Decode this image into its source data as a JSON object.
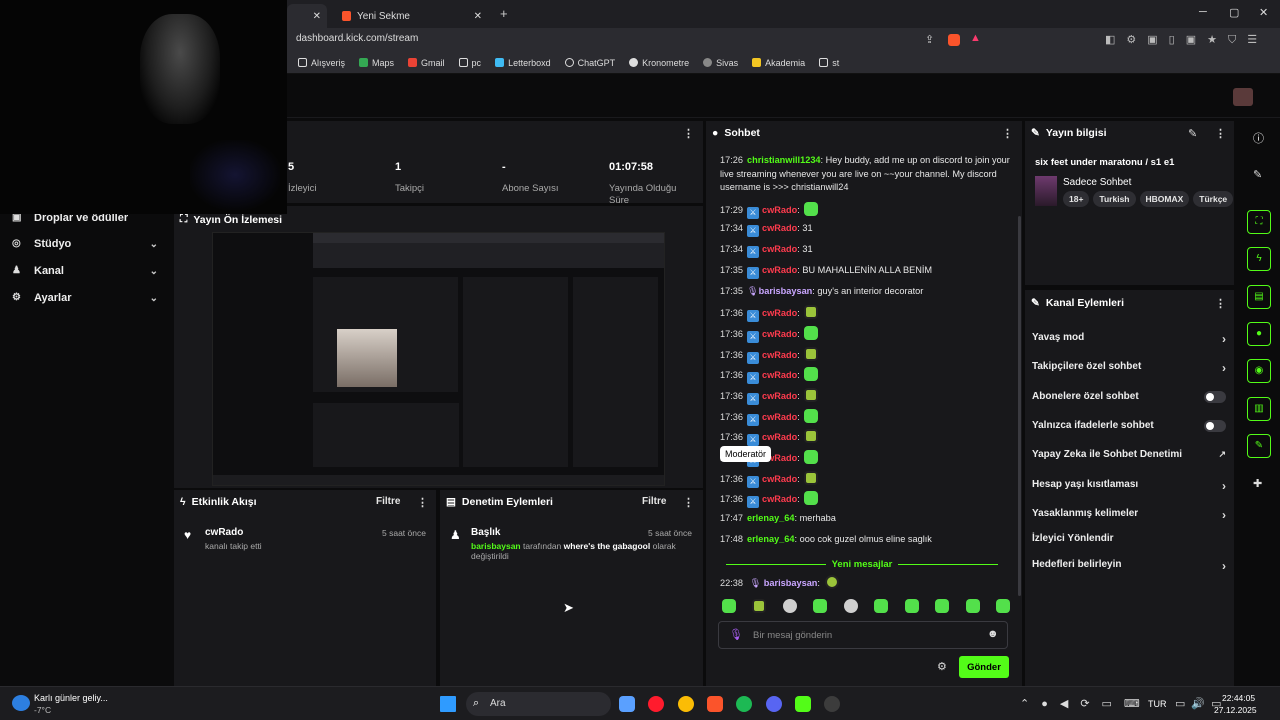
{
  "browser": {
    "tabs": [
      {
        "label": ""
      },
      {
        "label": "Yeni Sekme"
      }
    ],
    "url": "dashboard.kick.com/stream",
    "bookmarks": [
      "Alışveriş",
      "Maps",
      "Gmail",
      "pc",
      "Letterboxd",
      "ChatGPT",
      "Kronometre",
      "Sivas",
      "Akademia",
      "st"
    ]
  },
  "sidebar": {
    "items": [
      {
        "label": "Droplar ve ödüller"
      },
      {
        "label": "Stüdyo"
      },
      {
        "label": "Kanal"
      },
      {
        "label": "Ayarlar"
      }
    ]
  },
  "stats": [
    {
      "value": "5",
      "label": "İzleyici"
    },
    {
      "value": "1",
      "label": "Takipçi"
    },
    {
      "value": "-",
      "label": "Abone Sayısı"
    },
    {
      "value": "01:07:58",
      "label": "Yayında Olduğu Süre"
    }
  ],
  "preview": {
    "title": "Yayın Ön İzlemesi"
  },
  "activity": {
    "title": "Etkinlik Akışı",
    "filter": "Filtre",
    "items": [
      {
        "user": "cwRado",
        "text": "kanalı takip etti",
        "time": "5 saat önce"
      }
    ]
  },
  "moderation": {
    "title": "Denetim Eylemleri",
    "filter": "Filtre",
    "items": [
      {
        "heading": "Başlık",
        "user": "barisbaysan",
        "text1": "tarafından",
        "bold": "where's the gabagool",
        "text2": "olarak değiştirildi",
        "time": "5 saat önce"
      }
    ]
  },
  "chat": {
    "title": "Sohbet",
    "messages": [
      {
        "time": "17:26",
        "user": "christianwill1234",
        "color": "#53fc18",
        "badge": false,
        "text": "Hey buddy, add me up on discord to join your live streaming whenever you are live on ~~your channel. My discord username is >>> christianwill24",
        "emote": ""
      },
      {
        "time": "17:29",
        "user": "cwRado",
        "color": "#ff3b4e",
        "badge": true,
        "text": "",
        "emote": "g"
      },
      {
        "time": "17:34",
        "user": "cwRado",
        "color": "#ff3b4e",
        "badge": true,
        "text": "31",
        "emote": ""
      },
      {
        "time": "17:34",
        "user": "cwRado",
        "color": "#ff3b4e",
        "badge": true,
        "text": "31",
        "emote": ""
      },
      {
        "time": "17:35",
        "user": "cwRado",
        "color": "#ff3b4e",
        "badge": true,
        "text": "BU MAHALLENİN ALLA BENİM",
        "emote": ""
      },
      {
        "time": "17:35",
        "user": "barisbaysan",
        "color": "#c9a6ff",
        "badge": false,
        "mic": true,
        "text": "guy's an interior decorator",
        "emote": ""
      },
      {
        "time": "17:36",
        "user": "cwRado",
        "color": "#ff3b4e",
        "badge": true,
        "text": "",
        "emote": "y"
      },
      {
        "time": "17:36",
        "user": "cwRado",
        "color": "#ff3b4e",
        "badge": true,
        "text": "",
        "emote": "g"
      },
      {
        "time": "17:36",
        "user": "cwRado",
        "color": "#ff3b4e",
        "badge": true,
        "text": "",
        "emote": "y"
      },
      {
        "time": "17:36",
        "user": "cwRado",
        "color": "#ff3b4e",
        "badge": true,
        "text": "",
        "emote": "g"
      },
      {
        "time": "17:36",
        "user": "cwRado",
        "color": "#ff3b4e",
        "badge": true,
        "text": "",
        "emote": "y"
      },
      {
        "time": "17:36",
        "user": "cwRado",
        "color": "#ff3b4e",
        "badge": true,
        "text": "",
        "emote": "g"
      },
      {
        "time": "17:36",
        "user": "cwRado",
        "color": "#ff3b4e",
        "badge": true,
        "text": "",
        "emote": "y"
      },
      {
        "time": "17:36",
        "user": "cwRado",
        "color": "#ff3b4e",
        "badge": true,
        "text": "",
        "emote": "g"
      },
      {
        "time": "17:36",
        "user": "cwRado",
        "color": "#ff3b4e",
        "badge": true,
        "text": "",
        "emote": "y"
      },
      {
        "time": "17:36",
        "user": "cwRado",
        "color": "#ff3b4e",
        "badge": true,
        "text": "",
        "emote": "g"
      },
      {
        "time": "17:47",
        "user": "erlenay_64",
        "color": "#53fc18",
        "badge": false,
        "text": "merhaba",
        "emote": ""
      },
      {
        "time": "17:48",
        "user": "erlenay_64",
        "color": "#53fc18",
        "badge": false,
        "text": "ooo cok guzel olmus eline saglık",
        "emote": ""
      }
    ],
    "new_messages": "Yeni mesajlar",
    "last": {
      "time": "22:38",
      "user": "barisbaysan",
      "color": "#c9a6ff"
    },
    "tooltip": "Moderatör",
    "placeholder": "Bir mesaj gönderin",
    "send": "Gönder"
  },
  "stream_info": {
    "title": "Yayın bilgisi",
    "stream_title": "six feet under maratonu / s1 e1",
    "category": "Sadece Sohbet",
    "tags": [
      "18+",
      "Turkish",
      "HBOMAX",
      "Türkçe"
    ]
  },
  "channel_actions": {
    "title": "Kanal Eylemleri",
    "items": [
      {
        "label": "Yavaş mod",
        "control": "chevron"
      },
      {
        "label": "Takipçilere özel sohbet",
        "control": "chevron"
      },
      {
        "label": "Abonelere özel sohbet",
        "control": "toggle"
      },
      {
        "label": "Yalnızca ifadelerle sohbet",
        "control": "toggle"
      },
      {
        "label": "Yapay Zeka ile Sohbet Denetimi",
        "control": "external"
      },
      {
        "label": "Hesap yaşı kısıtlaması",
        "control": "chevron"
      },
      {
        "label": "Yasaklanmış kelimeler",
        "control": "chevron"
      },
      {
        "label": "İzleyici Yönlendir",
        "control": "none"
      },
      {
        "label": "Hedefleri belirleyin",
        "control": "chevron"
      }
    ]
  },
  "taskbar": {
    "weather_title": "Karlı günler geliy...",
    "weather_temp": "-7°C",
    "search": "Ara",
    "lang": "TUR",
    "time": "22:44:05",
    "date": "27.12.2025"
  },
  "colors": {
    "accent": "#53fc18",
    "panel": "#18181b",
    "mod": "#ff3b4e"
  }
}
